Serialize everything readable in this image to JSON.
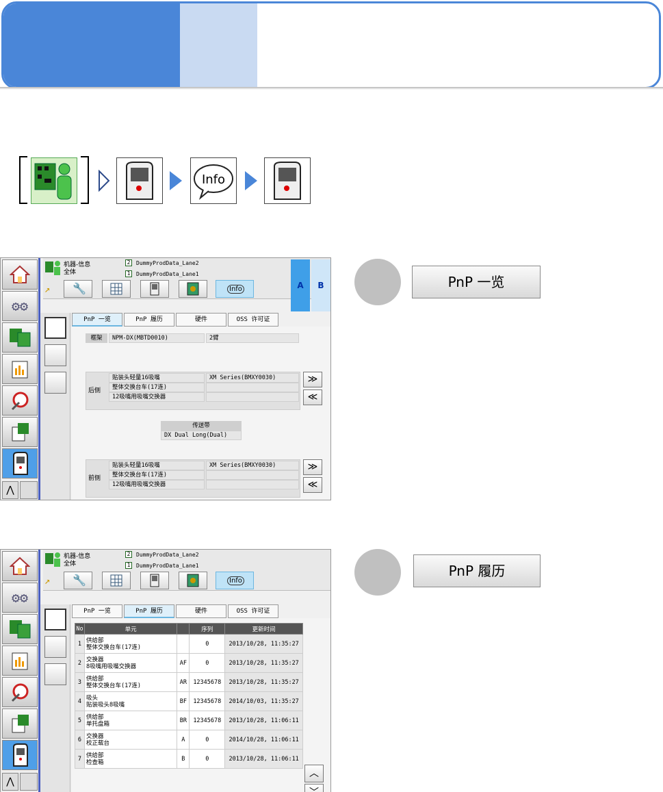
{
  "banner": {
    "colors": {
      "accent": "#4a86d8",
      "light": "#c9daf2"
    }
  },
  "nav_path": {
    "icons": [
      "machine-info-icon",
      "machine-icon",
      "info-icon",
      "machine-icon"
    ],
    "info_label": "Info"
  },
  "panel1": {
    "circle_button": "PnP 一览",
    "machine": {
      "title": "机器-信息",
      "scope": "全体",
      "lane2": "DummyProdData_Lane2",
      "lane1": "DummyProdData_Lane1",
      "lane2_num": "2",
      "lane1_num": "1",
      "info_btn": "Info",
      "side_a": "A",
      "side_b": "B"
    },
    "tabs": [
      "PnP 一览",
      "PnP 履历",
      "硬件",
      "OSS 许可证"
    ],
    "frame_label": "框架",
    "frame_value": "NPM-DX(MBTD0010)",
    "arm_value": "2臂",
    "rear": {
      "label": "后侧",
      "rows": [
        "贴装头轻量16吸嘴",
        "整体交换台车(17连)",
        "12吸嘴用吸嘴交换器"
      ],
      "right": [
        "XM Series(BMXY0030)",
        "",
        ""
      ]
    },
    "conveyor": {
      "header": "传送带",
      "value": "DX Dual Long(Dual)"
    },
    "front": {
      "label": "前侧",
      "rows": [
        "贴装头轻量16吸嘴",
        "整体交换台车(17连)",
        "12吸嘴用吸嘴交换器"
      ],
      "right": [
        "XM Series(BMXY0030)",
        "",
        ""
      ]
    },
    "scroll_down": "≫",
    "scroll_up": "≪"
  },
  "panel2": {
    "circle_button": "PnP 履历",
    "machine": {
      "title": "机器-信息",
      "scope": "全体",
      "lane2": "DummyProdData_Lane2",
      "lane1": "DummyProdData_Lane1",
      "lane2_num": "2",
      "lane1_num": "1",
      "info_btn": "Info"
    },
    "tabs": [
      "PnP 一览",
      "PnP 履历",
      "硬件",
      "OSS 许可证"
    ],
    "table": {
      "headers": [
        "No",
        "单元",
        "",
        "序列",
        "更新时间"
      ],
      "rows": [
        {
          "no": "1",
          "unit1": "供给部",
          "unit2": "整体交换台车(17连)",
          "code": "",
          "serial": "0",
          "time": "2013/10/28, 11:35:27"
        },
        {
          "no": "2",
          "unit1": "交换器",
          "unit2": "8吸嘴用吸嘴交换器",
          "code": "AF",
          "serial": "0",
          "time": "2013/10/28, 11:35:27"
        },
        {
          "no": "3",
          "unit1": "供给部",
          "unit2": "整体交换台车(17连)",
          "code": "AR",
          "serial": "12345678",
          "time": "2013/10/28, 11:35:27"
        },
        {
          "no": "4",
          "unit1": "吸头",
          "unit2": "贴装吸头8吸嘴",
          "code": "BF",
          "serial": "12345678",
          "time": "2014/10/03, 11:35:27"
        },
        {
          "no": "5",
          "unit1": "供给部",
          "unit2": "单托盘箱",
          "code": "BR",
          "serial": "12345678",
          "time": "2013/10/28, 11:06:11"
        },
        {
          "no": "6",
          "unit1": "交换器",
          "unit2": "校正载台",
          "code": "A",
          "serial": "0",
          "time": "2014/10/28, 11:06:11"
        },
        {
          "no": "7",
          "unit1": "供给部",
          "unit2": "检查箱",
          "code": "B",
          "serial": "0",
          "time": "2013/10/28, 11:06:11"
        }
      ]
    },
    "scroll_up": "︿",
    "scroll_down": "﹀"
  }
}
